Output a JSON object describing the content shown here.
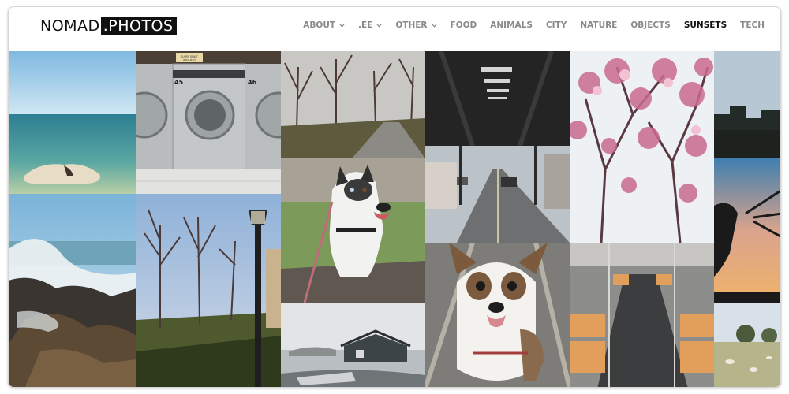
{
  "logo": {
    "part1": "NOMAD",
    "part2": ".PHOTOS"
  },
  "nav": [
    {
      "label": "ABOUT",
      "dropdown": true,
      "active": false,
      "name": "nav-about"
    },
    {
      "label": ".EE",
      "dropdown": true,
      "active": false,
      "name": "nav-ee"
    },
    {
      "label": "OTHER",
      "dropdown": true,
      "active": false,
      "name": "nav-other"
    },
    {
      "label": "FOOD",
      "dropdown": false,
      "active": false,
      "name": "nav-food"
    },
    {
      "label": "ANIMALS",
      "dropdown": false,
      "active": false,
      "name": "nav-animals"
    },
    {
      "label": "CITY",
      "dropdown": false,
      "active": false,
      "name": "nav-city"
    },
    {
      "label": "NATURE",
      "dropdown": false,
      "active": false,
      "name": "nav-nature"
    },
    {
      "label": "OBJECTS",
      "dropdown": false,
      "active": false,
      "name": "nav-objects"
    },
    {
      "label": "SUNSETS",
      "dropdown": false,
      "active": true,
      "name": "nav-sunsets"
    },
    {
      "label": "TECH",
      "dropdown": false,
      "active": false,
      "name": "nav-tech"
    }
  ],
  "laundromat_sign": "SUPER GIANT WASHERS",
  "washer_numbers": [
    "45",
    "46"
  ],
  "colors": {
    "active_nav": "#111111",
    "inactive_nav": "#8a8a8a",
    "logo_bg": "#111111"
  }
}
